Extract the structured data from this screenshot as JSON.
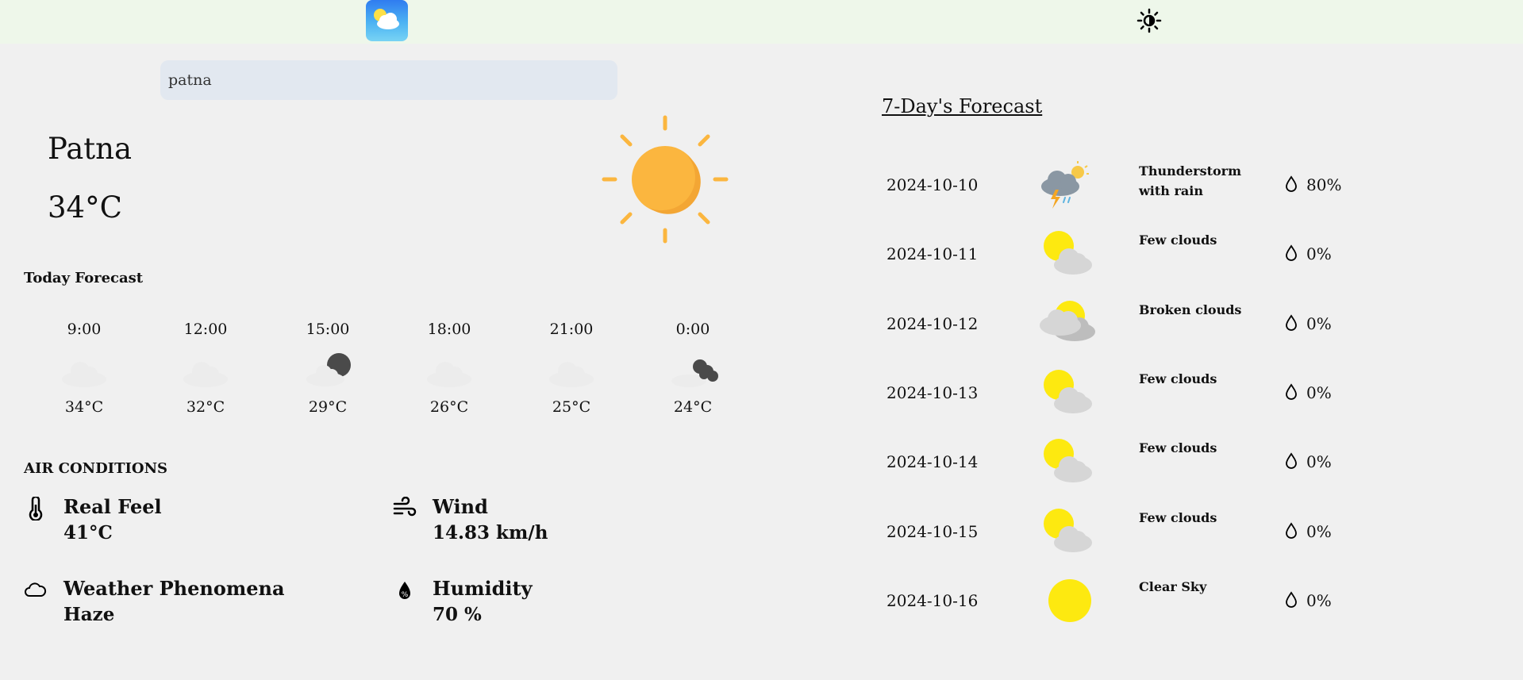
{
  "header": {
    "logo_icon": "weather-app-icon",
    "theme_icon": "brightness-toggle-icon"
  },
  "search": {
    "value": "patna"
  },
  "current": {
    "city": "Patna",
    "temp": "34°C",
    "icon": "sun-icon"
  },
  "today": {
    "title": "Today Forecast",
    "hours": [
      {
        "time": "9:00",
        "temp": "34°C",
        "icon": "haze-cloud-icon"
      },
      {
        "time": "12:00",
        "temp": "32°C",
        "icon": "haze-cloud-icon"
      },
      {
        "time": "15:00",
        "temp": "29°C",
        "icon": "moon-cloud-icon"
      },
      {
        "time": "18:00",
        "temp": "26°C",
        "icon": "haze-cloud-icon"
      },
      {
        "time": "21:00",
        "temp": "25°C",
        "icon": "haze-cloud-icon"
      },
      {
        "time": "0:00",
        "temp": "24°C",
        "icon": "dark-cloud-icon"
      }
    ]
  },
  "air": {
    "title": "AIR CONDITIONS",
    "real_feel": {
      "label": "Real Feel",
      "value": "41°C",
      "icon": "thermometer-icon"
    },
    "wind": {
      "label": "Wind",
      "value": "14.83 km/h",
      "icon": "wind-icon"
    },
    "phenomena": {
      "label": "Weather Phenomena",
      "value": "Haze",
      "icon": "cloud-outline-icon"
    },
    "humidity": {
      "label": "Humidity",
      "value": "70 %",
      "icon": "humidity-drop-icon"
    }
  },
  "forecast": {
    "title": "7-Day's Forecast",
    "days": [
      {
        "date": "2024-10-10",
        "desc": "Thunderstorm with rain",
        "pop": "80%",
        "icon": "thunderstorm-icon"
      },
      {
        "date": "2024-10-11",
        "desc": "Few clouds",
        "pop": "0%",
        "icon": "few-clouds-icon"
      },
      {
        "date": "2024-10-12",
        "desc": "Broken clouds",
        "pop": "0%",
        "icon": "broken-clouds-icon"
      },
      {
        "date": "2024-10-13",
        "desc": "Few clouds",
        "pop": "0%",
        "icon": "few-clouds-icon"
      },
      {
        "date": "2024-10-14",
        "desc": "Few clouds",
        "pop": "0%",
        "icon": "few-clouds-icon"
      },
      {
        "date": "2024-10-15",
        "desc": "Few clouds",
        "pop": "0%",
        "icon": "few-clouds-icon"
      },
      {
        "date": "2024-10-16",
        "desc": "Clear Sky",
        "pop": "0%",
        "icon": "clear-sky-icon"
      }
    ]
  },
  "colors": {
    "topbar": "#eef7ea",
    "background": "#f0f0f0",
    "sun": "#fbb63f",
    "yellow": "#fde910",
    "cloud": "#d6d6d6"
  }
}
